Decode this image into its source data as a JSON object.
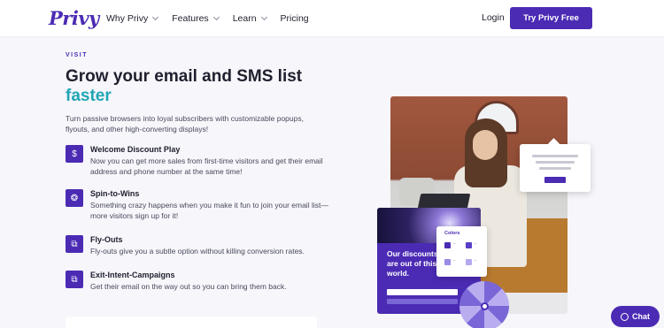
{
  "header": {
    "logo": "Privy",
    "nav": [
      {
        "label": "Why Privy",
        "dropdown": true
      },
      {
        "label": "Features",
        "dropdown": true
      },
      {
        "label": "Learn",
        "dropdown": true
      },
      {
        "label": "Pricing",
        "dropdown": false
      }
    ],
    "login": "Login",
    "cta": "Try Privy Free"
  },
  "hero": {
    "eyebrow": "VISIT",
    "title_line1": "Grow your email and SMS list",
    "title_line2": "faster",
    "intro": "Turn passive browsers into loyal subscribers with customizable popups, flyouts, and other high-converting displays!"
  },
  "features": [
    {
      "icon": "dollar-icon",
      "glyph": "$",
      "title": "Welcome Discount Play",
      "desc": "Now you can get more sales from first-time visitors and get their email address and phone number at the same time!"
    },
    {
      "icon": "spin-icon",
      "glyph": "❂",
      "title": "Spin-to-Wins",
      "desc": "Something crazy happens when you make it fun to join your email list—more visitors sign up for it!"
    },
    {
      "icon": "flyout-icon",
      "glyph": "⧉",
      "title": "Fly-Outs",
      "desc": "Fly-outs give you a subtle option without killing conversion rates."
    },
    {
      "icon": "exit-intent-icon",
      "glyph": "⧉",
      "title": "Exit-Intent-Campaigns",
      "desc": "Get their email on the way out so you can bring them back."
    }
  ],
  "visual": {
    "promo_text": "Our discounts are out of this world.",
    "colors_label": "Colors",
    "swatch_dash": "-"
  },
  "chat": {
    "label": "Chat"
  },
  "colors": {
    "brand": "#4b2bb4",
    "accent_teal": "#21a6b5"
  }
}
